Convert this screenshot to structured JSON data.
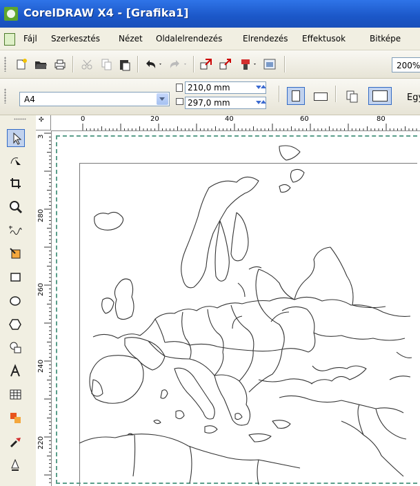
{
  "window": {
    "title": "CorelDRAW X4 - [Grafika1]"
  },
  "menu": {
    "items": [
      "Fájl",
      "Szerkesztés",
      "Nézet",
      "Oldalelrendezés",
      "Elrendezés",
      "Effektusok",
      "Bitképe"
    ]
  },
  "toolbar": {
    "zoom": "200%",
    "icons": [
      "new-icon",
      "open-icon",
      "print-icon",
      "cut-icon",
      "copy-icon",
      "paste-icon",
      "undo-icon",
      "redo-icon",
      "import-icon",
      "export-icon",
      "app-launcher-icon",
      "welcome-icon"
    ]
  },
  "property_bar": {
    "page_size": "A4",
    "width": "210,0 mm",
    "height": "297,0 mm",
    "truncated_label": "Egy"
  },
  "toolbox": {
    "tools": [
      "pick-tool-icon",
      "shape-tool-icon",
      "crop-tool-icon",
      "zoom-tool-icon",
      "freehand-tool-icon",
      "smart-fill-tool-icon",
      "rectangle-tool-icon",
      "ellipse-tool-icon",
      "polygon-tool-icon",
      "basic-shapes-tool-icon",
      "text-tool-icon",
      "table-tool-icon",
      "interactive-tool-icon",
      "eyedropper-tool-icon",
      "outline-tool-icon"
    ]
  },
  "rulers": {
    "horizontal": [
      "0",
      "20",
      "40",
      "60",
      "80"
    ],
    "vertical": [
      "280",
      "260",
      "240",
      "220"
    ],
    "corner_vertical_partial": "3"
  },
  "colors": {
    "titlebar": "#1b57c8",
    "page_border": "#5a9e8a",
    "selection": "#316ac5"
  }
}
